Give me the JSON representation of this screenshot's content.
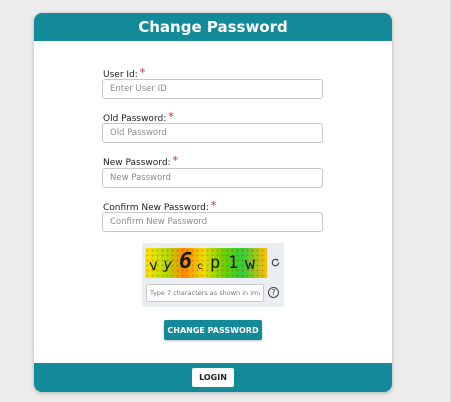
{
  "header": {
    "title": "Change Password"
  },
  "fields": {
    "user_id": {
      "label": "User Id:",
      "required": "*",
      "placeholder": "Enter User ID",
      "value": ""
    },
    "old_password": {
      "label": "Old Password:",
      "required": "*",
      "placeholder": "Old Password",
      "value": ""
    },
    "new_password": {
      "label": "New Password:",
      "required": "*",
      "placeholder": "New Password",
      "value": ""
    },
    "confirm_password": {
      "label": "Confirm New Password:",
      "required": "*",
      "placeholder": "Confirm New Password",
      "value": ""
    }
  },
  "captcha": {
    "chars": [
      "v",
      "y",
      "6",
      "c",
      "p",
      "1",
      "w"
    ],
    "input_placeholder": "Type 7 characters as shown in image",
    "help_symbol": "?",
    "refresh_icon": "refresh-icon",
    "help_icon": "question-circle-icon"
  },
  "actions": {
    "change_password_label": "CHANGE PASSWORD",
    "login_label": "LOGIN"
  },
  "colors": {
    "primary": "#138a99",
    "background": "#ececec",
    "required": "#e02020"
  }
}
